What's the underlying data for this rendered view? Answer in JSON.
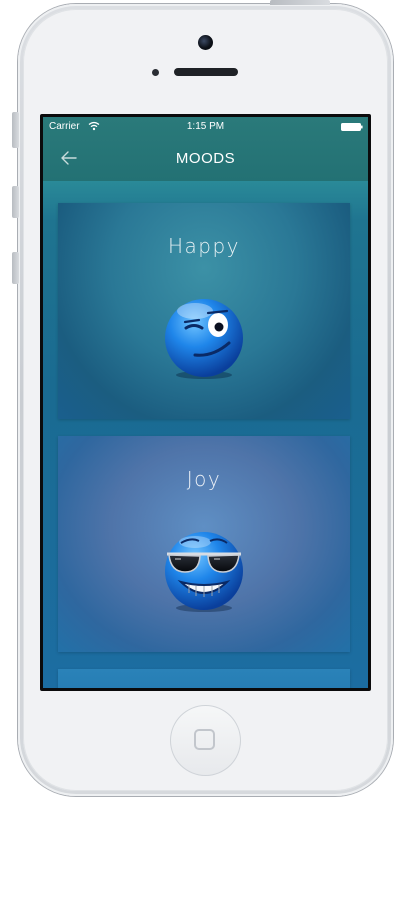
{
  "status_bar": {
    "carrier": "Carrier",
    "time": "1:15 PM",
    "wifi_icon": "wifi-icon",
    "battery_icon": "battery-icon"
  },
  "nav": {
    "title": "MOODS",
    "back_icon": "back-arrow-icon"
  },
  "moods": [
    {
      "label": "Happy",
      "emoji_icon": "winking-smiley-icon"
    },
    {
      "label": "Joy",
      "emoji_icon": "sunglasses-smiley-icon"
    }
  ],
  "colors": {
    "header": "#237174",
    "content": "#1b6a93",
    "emoji_blue": "#1d7fe0"
  }
}
